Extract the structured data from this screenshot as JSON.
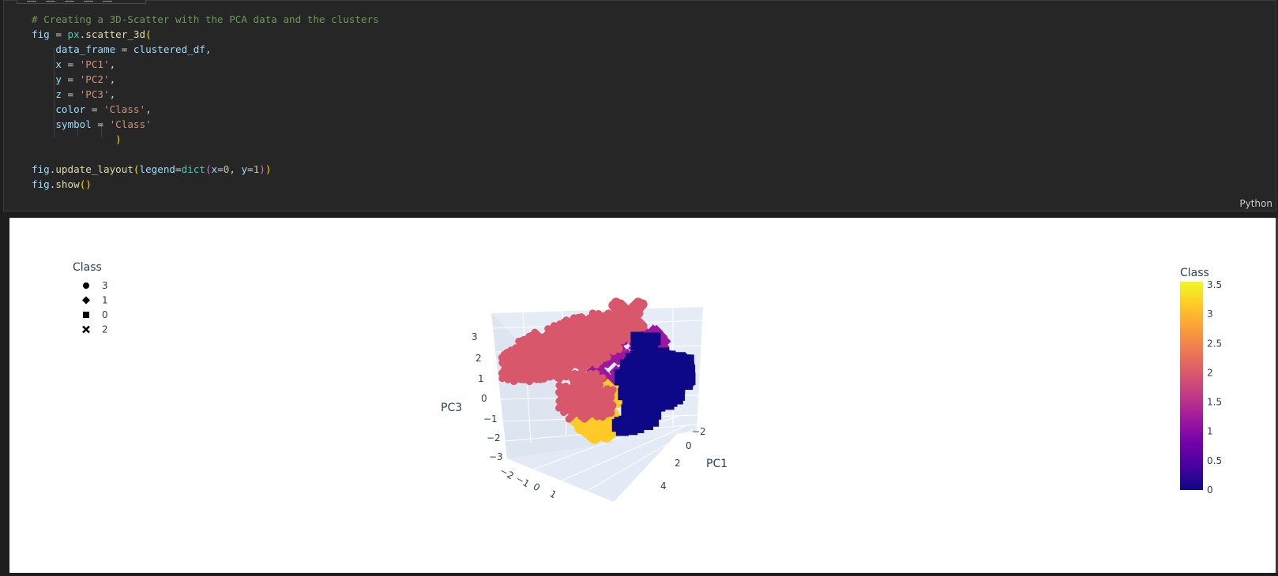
{
  "code_cell": {
    "language_label": "Python",
    "lines": [
      [
        {
          "t": "# Creating a 3D-Scatter with the PCA data and the clusters",
          "c": "c-com"
        }
      ],
      [
        {
          "t": "fig",
          "c": "c-var"
        },
        {
          "t": " = "
        },
        {
          "t": "px",
          "c": "c-cls"
        },
        {
          "t": "."
        },
        {
          "t": "scatter_3d",
          "c": "c-fn"
        },
        {
          "t": "(",
          "c": "c-br1"
        }
      ],
      [
        {
          "t": "    "
        },
        {
          "t": "data_frame",
          "c": "c-var"
        },
        {
          "t": " = "
        },
        {
          "t": "clustered_df",
          "c": "c-var"
        },
        {
          "t": ","
        }
      ],
      [
        {
          "t": "    "
        },
        {
          "t": "x",
          "c": "c-var"
        },
        {
          "t": " = "
        },
        {
          "t": "'PC1'",
          "c": "c-str"
        },
        {
          "t": ","
        }
      ],
      [
        {
          "t": "    "
        },
        {
          "t": "y",
          "c": "c-var"
        },
        {
          "t": " = "
        },
        {
          "t": "'PC2'",
          "c": "c-str"
        },
        {
          "t": ","
        }
      ],
      [
        {
          "t": "    "
        },
        {
          "t": "z",
          "c": "c-var"
        },
        {
          "t": " = "
        },
        {
          "t": "'PC3'",
          "c": "c-str"
        },
        {
          "t": ","
        }
      ],
      [
        {
          "t": "    "
        },
        {
          "t": "color",
          "c": "c-var"
        },
        {
          "t": " = "
        },
        {
          "t": "'Class'",
          "c": "c-str"
        },
        {
          "t": ","
        }
      ],
      [
        {
          "t": "    "
        },
        {
          "t": "symbol",
          "c": "c-var"
        },
        {
          "t": " = "
        },
        {
          "t": "'Class'",
          "c": "c-str"
        }
      ],
      [
        {
          "t": "              "
        },
        {
          "t": ")",
          "c": "c-br1"
        }
      ],
      [
        {
          "t": ""
        }
      ],
      [
        {
          "t": "fig",
          "c": "c-var"
        },
        {
          "t": "."
        },
        {
          "t": "update_layout",
          "c": "c-fn"
        },
        {
          "t": "(",
          "c": "c-br1"
        },
        {
          "t": "legend",
          "c": "c-var"
        },
        {
          "t": "="
        },
        {
          "t": "dict",
          "c": "c-cls"
        },
        {
          "t": "(",
          "c": "c-br2"
        },
        {
          "t": "x",
          "c": "c-var"
        },
        {
          "t": "="
        },
        {
          "t": "0",
          "c": "c-num"
        },
        {
          "t": ", "
        },
        {
          "t": "y",
          "c": "c-var"
        },
        {
          "t": "="
        },
        {
          "t": "1",
          "c": "c-num"
        },
        {
          "t": ")",
          "c": "c-br2"
        },
        {
          "t": ")",
          "c": "c-br1"
        }
      ],
      [
        {
          "t": "fig",
          "c": "c-var"
        },
        {
          "t": "."
        },
        {
          "t": "show",
          "c": "c-fn"
        },
        {
          "t": "()",
          "c": "c-br1"
        }
      ]
    ]
  },
  "plot": {
    "legend": {
      "title": "Class",
      "items": [
        {
          "label": "3",
          "symbol": "circle"
        },
        {
          "label": "1",
          "symbol": "diamond"
        },
        {
          "label": "0",
          "symbol": "square"
        },
        {
          "label": "2",
          "symbol": "x"
        }
      ]
    },
    "colorbar": {
      "title": "Class",
      "ticks": [
        "3.5",
        "3",
        "2.5",
        "2",
        "1.5",
        "1",
        "0.5",
        "0"
      ],
      "colors": [
        "#f0f921",
        "#fdca26",
        "#fb9f3a",
        "#ed7953",
        "#d8576b",
        "#bd3786",
        "#9c179e",
        "#7201a8",
        "#46039f",
        "#0d0887"
      ]
    },
    "axes": {
      "z_title": "PC3",
      "x_title": "PC1",
      "z_ticks": [
        "3",
        "2",
        "1",
        "0",
        "−1",
        "−2",
        "−3"
      ],
      "x_ticks": [
        "−2",
        "0",
        "2",
        "4"
      ],
      "y_ticks": [
        "−2",
        "−1",
        "0",
        "1"
      ]
    }
  },
  "chart_data": {
    "type": "scatter",
    "dimensions": 3,
    "x": "PC1",
    "y": "PC2",
    "z": "PC3",
    "color_by": "Class",
    "symbol_by": "Class",
    "series": [
      {
        "name": "3",
        "symbol": "circle",
        "color": "#fdca26"
      },
      {
        "name": "1",
        "symbol": "diamond",
        "color": "#9c179e"
      },
      {
        "name": "0",
        "symbol": "square",
        "color": "#0d0887"
      },
      {
        "name": "2",
        "symbol": "x",
        "color": "#d8576b"
      }
    ],
    "colorbar_range": [
      0,
      3.5
    ],
    "z_range": [
      -3,
      3
    ],
    "x_range": [
      -2,
      4
    ],
    "y_range": [
      -2,
      1
    ]
  }
}
